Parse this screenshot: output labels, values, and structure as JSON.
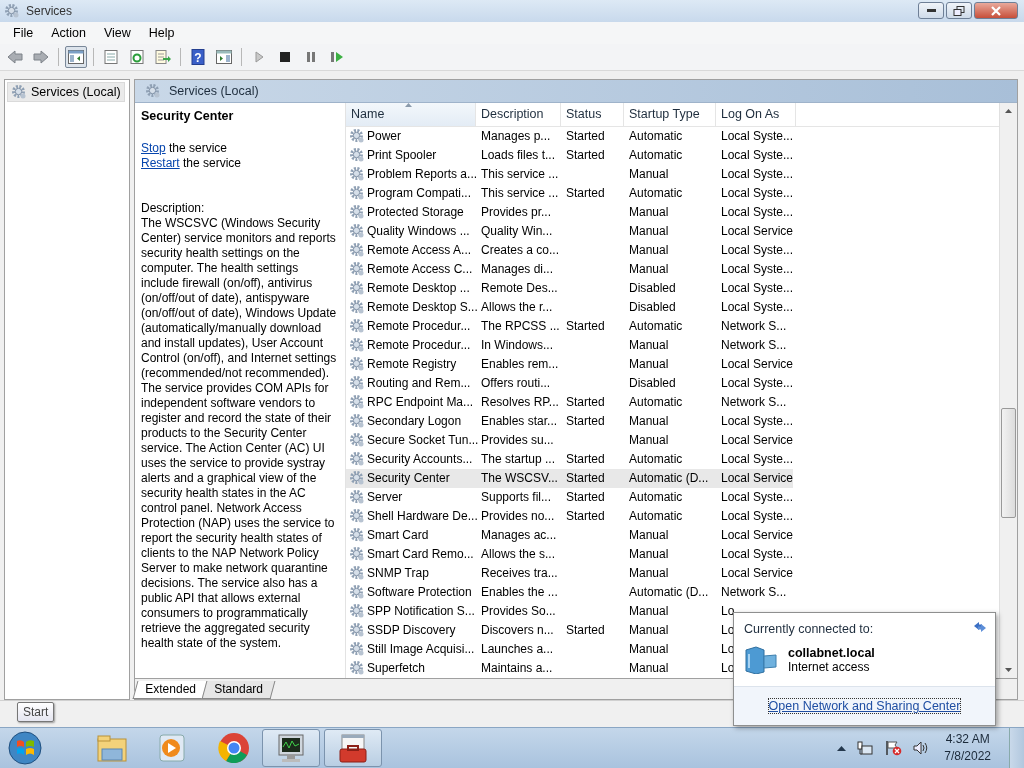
{
  "window": {
    "title": "Services"
  },
  "menu": [
    "File",
    "Action",
    "View",
    "Help"
  ],
  "toolbar": {
    "help_glyph": "?"
  },
  "tree": [
    {
      "label": "Services (Local)",
      "selected": true
    }
  ],
  "panel_title": "Services (Local)",
  "details": {
    "service_name": "Security Center",
    "actions": [
      {
        "link": "Stop",
        "text": " the service"
      },
      {
        "link": "Restart",
        "text": " the service"
      }
    ],
    "description_label": "Description:",
    "description": "The WSCSVC (Windows Security Center) service monitors and reports security health settings on the computer. The health settings include firewall (on/off), antivirus (on/off/out of date), antispyware (on/off/out of date), Windows Update (automatically/manually download and install updates), User Account Control (on/off), and Internet settings (recommended/not recommended). The service provides COM APIs for independent software vendors to register and record the state of their products to the Security Center service. The Action Center (AC) UI uses the service to provide systray alerts and a graphical view of the security health states in the AC control panel. Network Access Protection (NAP) uses the service to report the security health states of clients to the NAP Network Policy Server to make network quarantine decisions. The service also has a public API that allows external consumers to programmatically retrieve the aggregated security health state of the system."
  },
  "table": {
    "columns": [
      "Name",
      "Description",
      "Status",
      "Startup Type",
      "Log On As"
    ],
    "rows": [
      {
        "name": "Power",
        "description": "Manages p...",
        "status": "Started",
        "startup_type": "Automatic",
        "log_on_as": "Local Syste...",
        "selected": false
      },
      {
        "name": "Print Spooler",
        "description": "Loads files t...",
        "status": "Started",
        "startup_type": "Automatic",
        "log_on_as": "Local Syste...",
        "selected": false
      },
      {
        "name": "Problem Reports a...",
        "description": "This service ...",
        "startup_type": "Manual",
        "log_on_as": "Local Syste...",
        "selected": false
      },
      {
        "name": "Program Compati...",
        "description": "This service ...",
        "status": "Started",
        "startup_type": "Automatic",
        "log_on_as": "Local Syste...",
        "selected": false
      },
      {
        "name": "Protected Storage",
        "description": "Provides pr...",
        "startup_type": "Manual",
        "log_on_as": "Local Syste...",
        "selected": false
      },
      {
        "name": "Quality Windows ...",
        "description": "Quality Win...",
        "startup_type": "Manual",
        "log_on_as": "Local Service",
        "selected": false
      },
      {
        "name": "Remote Access A...",
        "description": "Creates a co...",
        "startup_type": "Manual",
        "log_on_as": "Local Syste...",
        "selected": false
      },
      {
        "name": "Remote Access C...",
        "description": "Manages di...",
        "startup_type": "Manual",
        "log_on_as": "Local Syste...",
        "selected": false
      },
      {
        "name": "Remote Desktop ...",
        "description": "Remote Des...",
        "startup_type": "Disabled",
        "log_on_as": "Local Syste...",
        "selected": false
      },
      {
        "name": "Remote Desktop S...",
        "description": "Allows the r...",
        "startup_type": "Disabled",
        "log_on_as": "Local Syste...",
        "selected": false
      },
      {
        "name": "Remote Procedur...",
        "description": "The RPCSS ...",
        "status": "Started",
        "startup_type": "Automatic",
        "log_on_as": "Network S...",
        "selected": false
      },
      {
        "name": "Remote Procedur...",
        "description": "In Windows...",
        "startup_type": "Manual",
        "log_on_as": "Network S...",
        "selected": false
      },
      {
        "name": "Remote Registry",
        "description": "Enables rem...",
        "startup_type": "Manual",
        "log_on_as": "Local Service",
        "selected": false
      },
      {
        "name": "Routing and Rem...",
        "description": "Offers routi...",
        "startup_type": "Disabled",
        "log_on_as": "Local Syste...",
        "selected": false
      },
      {
        "name": "RPC Endpoint Ma...",
        "description": "Resolves RP...",
        "status": "Started",
        "startup_type": "Automatic",
        "log_on_as": "Network S...",
        "selected": false
      },
      {
        "name": "Secondary Logon",
        "description": "Enables star...",
        "status": "Started",
        "startup_type": "Manual",
        "log_on_as": "Local Syste...",
        "selected": false
      },
      {
        "name": "Secure Socket Tun...",
        "description": "Provides su...",
        "startup_type": "Manual",
        "log_on_as": "Local Service",
        "selected": false
      },
      {
        "name": "Security Accounts...",
        "description": "The startup ...",
        "status": "Started",
        "startup_type": "Automatic",
        "log_on_as": "Local Syste...",
        "selected": false
      },
      {
        "name": "Security Center",
        "description": "The WSCSV...",
        "status": "Started",
        "startup_type": "Automatic (D...",
        "log_on_as": "Local Service",
        "selected": true
      },
      {
        "name": "Server",
        "description": "Supports fil...",
        "status": "Started",
        "startup_type": "Automatic",
        "log_on_as": "Local Syste...",
        "selected": false
      },
      {
        "name": "Shell Hardware De...",
        "description": "Provides no...",
        "status": "Started",
        "startup_type": "Automatic",
        "log_on_as": "Local Syste...",
        "selected": false
      },
      {
        "name": "Smart Card",
        "description": "Manages ac...",
        "startup_type": "Manual",
        "log_on_as": "Local Service",
        "selected": false
      },
      {
        "name": "Smart Card Remo...",
        "description": "Allows the s...",
        "startup_type": "Manual",
        "log_on_as": "Local Syste...",
        "selected": false
      },
      {
        "name": "SNMP Trap",
        "description": "Receives tra...",
        "startup_type": "Manual",
        "log_on_as": "Local Service",
        "selected": false
      },
      {
        "name": "Software Protection",
        "description": "Enables the ...",
        "startup_type": "Automatic (D...",
        "log_on_as": "Network S...",
        "selected": false
      },
      {
        "name": "SPP Notification S...",
        "description": "Provides So...",
        "startup_type": "Manual",
        "log_on_as": "Lo",
        "selected": false
      },
      {
        "name": "SSDP Discovery",
        "description": "Discovers n...",
        "status": "Started",
        "startup_type": "Manual",
        "log_on_as": "Lo",
        "selected": false
      },
      {
        "name": "Still Image Acquisi...",
        "description": "Launches a...",
        "startup_type": "Manual",
        "log_on_as": "Lo",
        "selected": false
      },
      {
        "name": "Superfetch",
        "description": "Maintains a...",
        "startup_type": "Manual",
        "log_on_as": "Lo",
        "selected": false
      }
    ]
  },
  "view_tabs": [
    {
      "label": "Extended",
      "selected": true
    },
    {
      "label": "Standard",
      "selected": false
    }
  ],
  "tooltip": "Start",
  "network_popup": {
    "heading": "Currently connected to:",
    "network": "collabnet.local",
    "access": "Internet access",
    "link": "Open Network and Sharing Center"
  },
  "clock": {
    "time": "4:32 AM",
    "date": "7/8/2022"
  }
}
